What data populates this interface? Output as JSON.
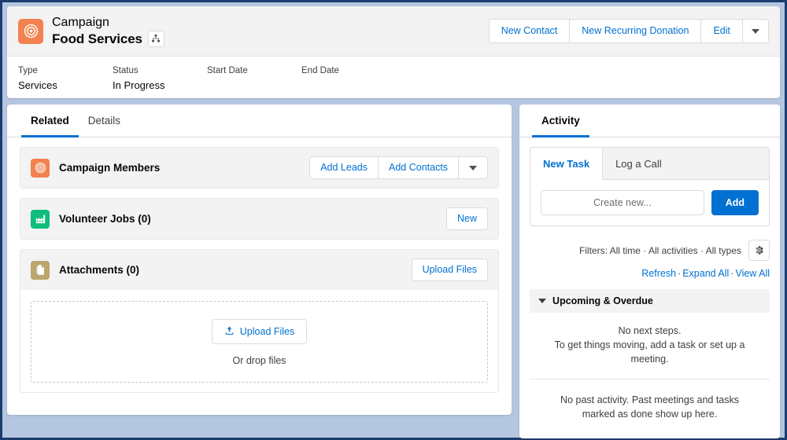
{
  "header": {
    "object_type": "Campaign",
    "record_title": "Food Services",
    "object_icon": "campaign-target-icon",
    "hierarchy_icon": "hierarchy-icon",
    "actions": [
      {
        "label": "New Contact"
      },
      {
        "label": "New Recurring Donation"
      },
      {
        "label": "Edit"
      }
    ],
    "more_actions_icon": "chevron-down-icon",
    "fields": [
      {
        "label": "Type",
        "value": "Services"
      },
      {
        "label": "Status",
        "value": "In Progress"
      },
      {
        "label": "Start Date",
        "value": ""
      },
      {
        "label": "End Date",
        "value": ""
      }
    ]
  },
  "left_panel": {
    "tabs": [
      {
        "label": "Related",
        "active": true
      },
      {
        "label": "Details",
        "active": false
      }
    ],
    "sections": [
      {
        "title": "Campaign Members",
        "icon": "campaign-target-icon",
        "actions": [
          {
            "label": "Add Leads"
          },
          {
            "label": "Add Contacts"
          }
        ],
        "has_caret": true
      },
      {
        "title": "Volunteer Jobs (0)",
        "icon": "volunteer-job-icon",
        "actions": [
          {
            "label": "New"
          }
        ],
        "has_caret": false
      },
      {
        "title": "Attachments (0)",
        "icon": "attachment-file-icon",
        "actions": [
          {
            "label": "Upload Files"
          }
        ],
        "has_caret": false
      }
    ],
    "dropzone": {
      "button_label": "Upload Files",
      "upload_icon": "upload-icon",
      "hint": "Or drop files"
    }
  },
  "right_panel": {
    "tabs": [
      {
        "label": "Activity",
        "active": true
      }
    ],
    "composer": {
      "tabs": [
        {
          "label": "New Task",
          "active": true
        },
        {
          "label": "Log a Call",
          "active": false
        }
      ],
      "input_value": "",
      "input_placeholder": "Create new...",
      "add_label": "Add"
    },
    "filters": {
      "text": "Filters: All time · All activities · All types",
      "settings_icon": "gear-icon"
    },
    "links": [
      {
        "label": "Refresh"
      },
      {
        "label": "Expand All"
      },
      {
        "label": "View All"
      }
    ],
    "link_separator": "·",
    "upcoming": {
      "title": "Upcoming & Overdue",
      "collapse_icon": "chevron-down-icon",
      "empty_line1": "No next steps.",
      "empty_line2": "To get things moving, add a task or set up a meeting."
    },
    "past": {
      "empty_text": "No past activity. Past meetings and tasks marked as done show up here."
    }
  },
  "colors": {
    "accent_blue": "#0070d2",
    "campaign_orange": "#f2824f",
    "volunteer_green": "#0fbd7c",
    "attachment_tan": "#baa76e",
    "page_background": "#b4c6e0"
  }
}
